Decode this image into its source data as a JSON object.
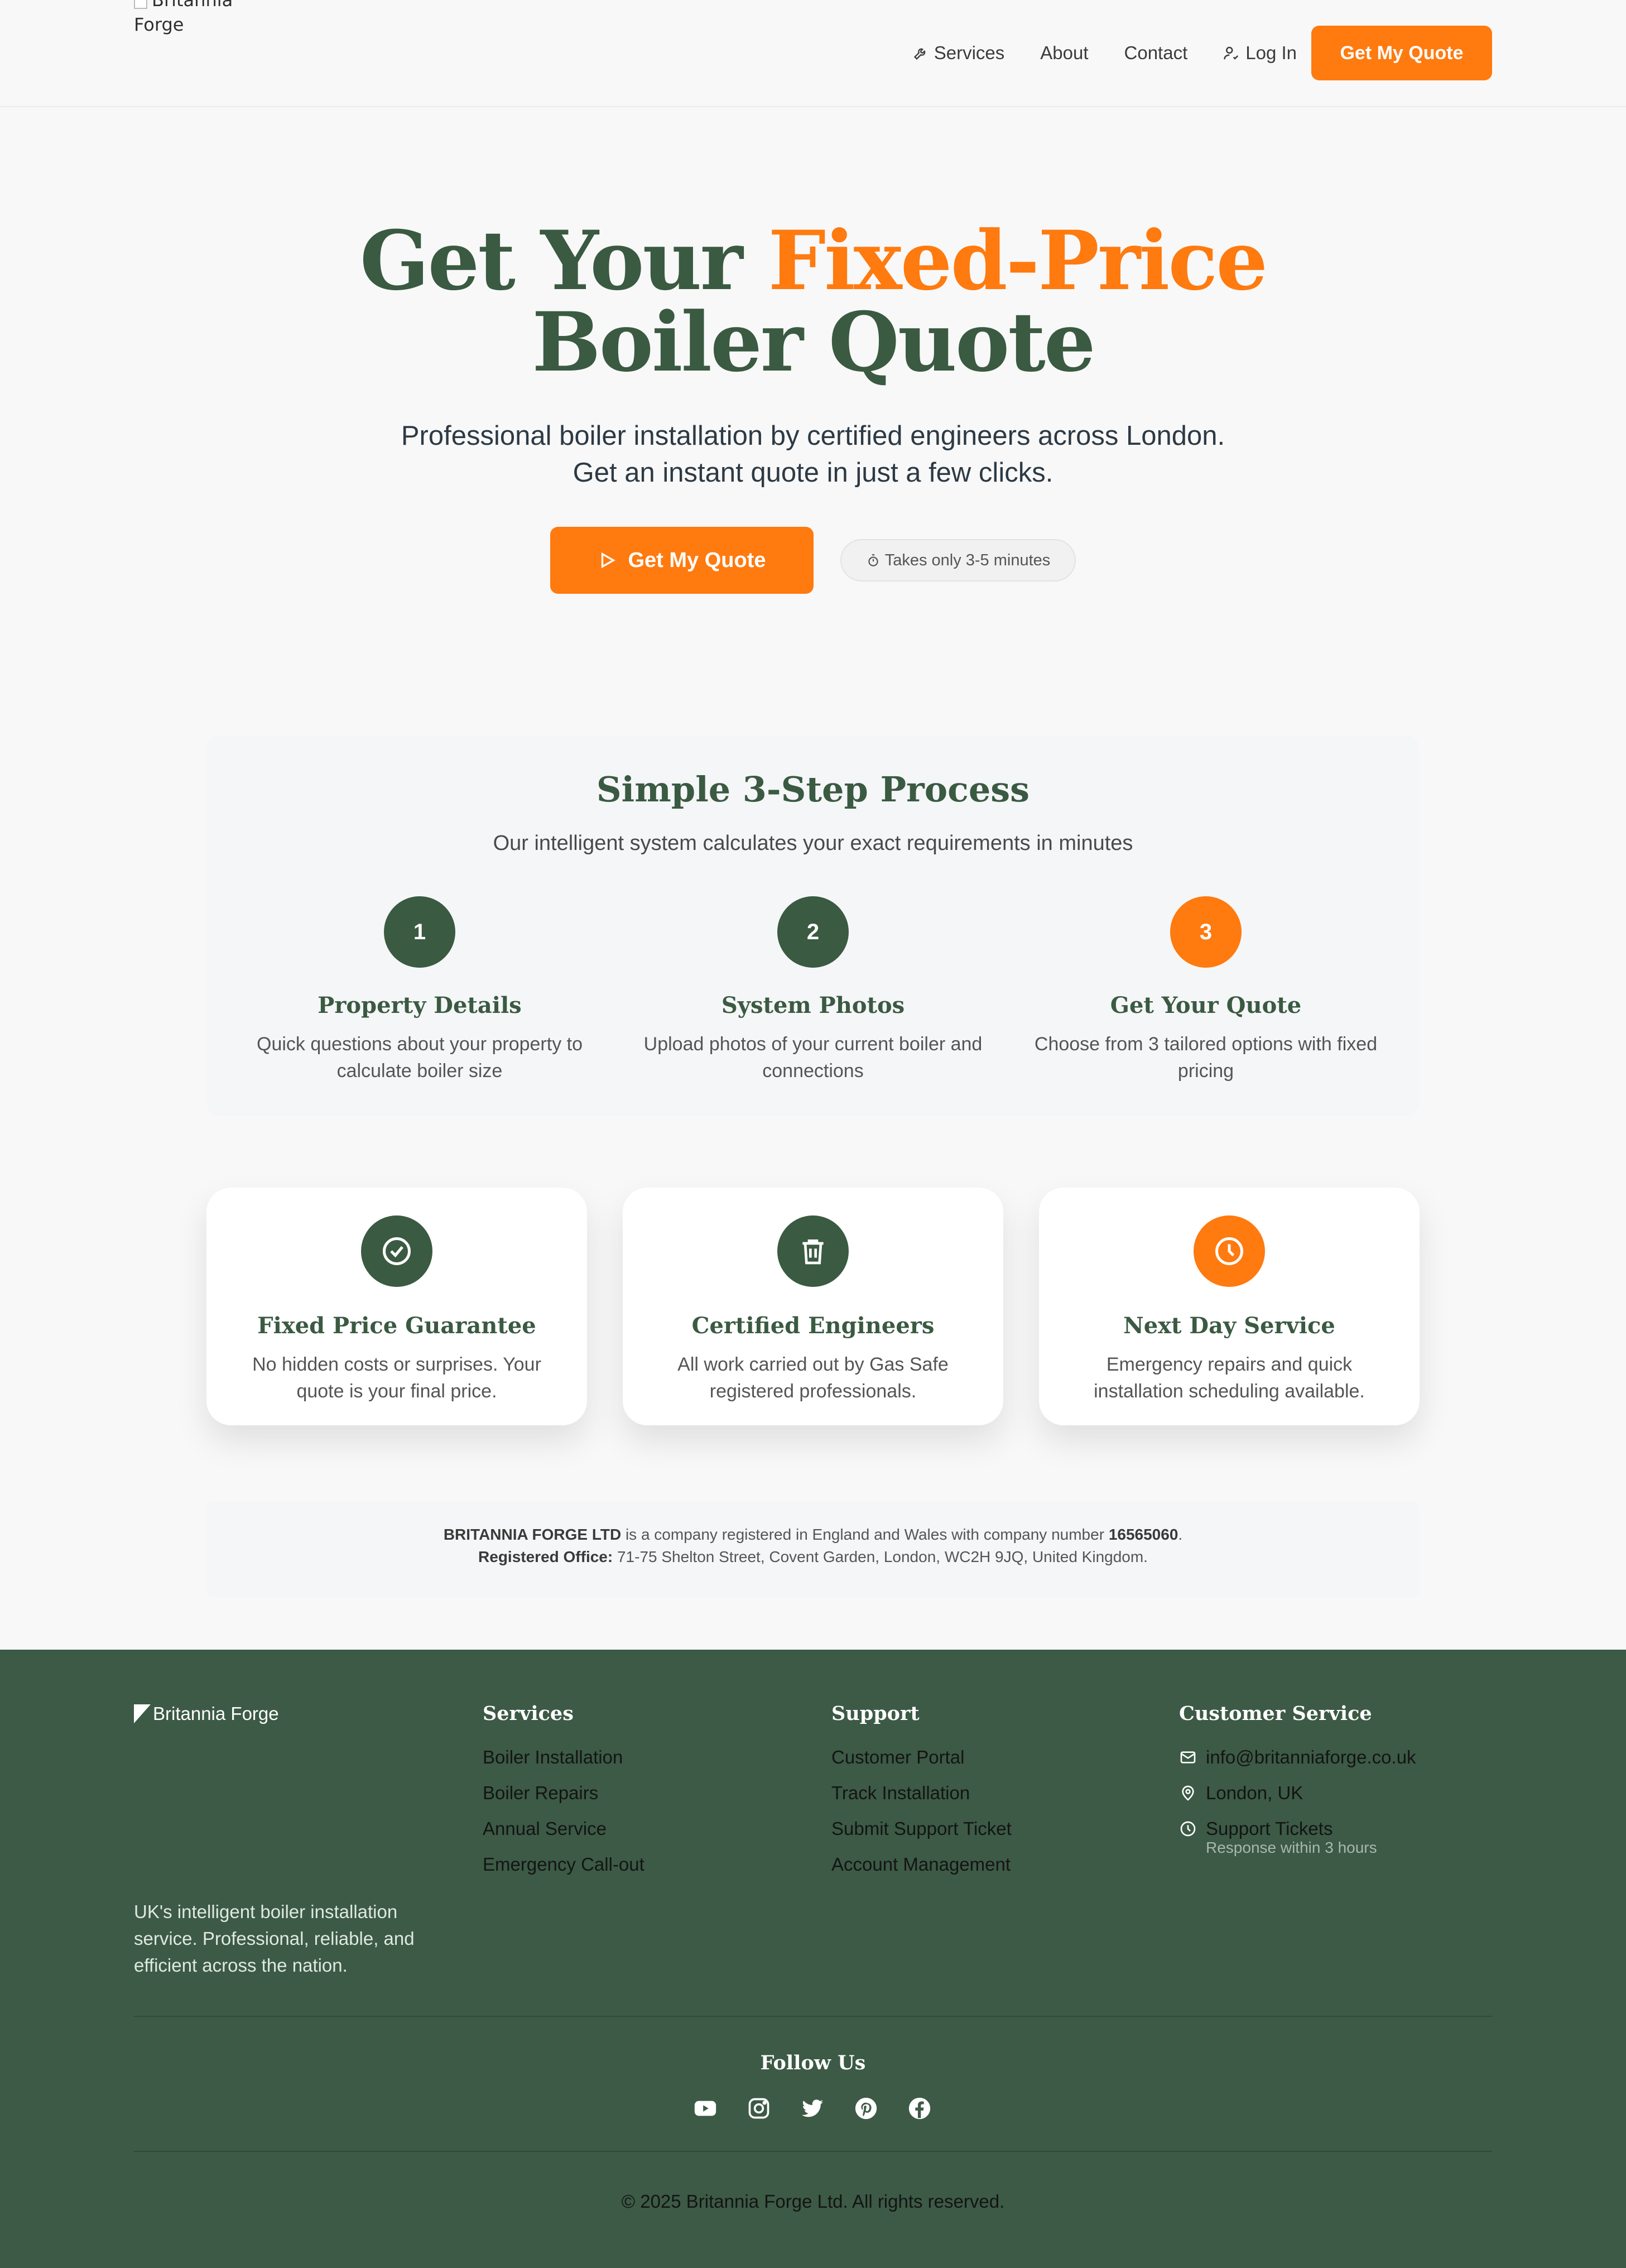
{
  "header": {
    "logo_text_line1": "Britannia",
    "logo_text_line2": "Forge",
    "nav": {
      "services": "Services",
      "about": "About",
      "contact": "Contact",
      "login": "Log In",
      "cta": "Get My Quote"
    }
  },
  "hero": {
    "title_part1": "Get Your ",
    "title_accent": "Fixed-Price",
    "title_line2": "Boiler Quote",
    "subtitle_line1": "Professional boiler installation by certified engineers across London.",
    "subtitle_line2": "Get an instant quote in just a few clicks.",
    "cta": "Get My Quote",
    "time_pill": "Takes only 3-5 minutes"
  },
  "process": {
    "title": "Simple 3-Step Process",
    "subtitle": "Our intelligent system calculates your exact requirements in minutes",
    "steps": [
      {
        "number": "1",
        "title": "Property Details",
        "desc": "Quick questions about your property to calculate boiler size"
      },
      {
        "number": "2",
        "title": "System Photos",
        "desc": "Upload photos of your current boiler and connections"
      },
      {
        "number": "3",
        "title": "Get Your Quote",
        "desc": "Choose from 3 tailored options with fixed pricing"
      }
    ]
  },
  "features": [
    {
      "icon": "check-circle-icon",
      "title": "Fixed Price Guarantee",
      "desc": "No hidden costs or surprises. Your quote is your final price."
    },
    {
      "icon": "trash-icon",
      "title": "Certified Engineers",
      "desc": "All work carried out by Gas Safe registered professionals."
    },
    {
      "icon": "clock-icon",
      "title": "Next Day Service",
      "desc": "Emergency repairs and quick installation scheduling available."
    }
  ],
  "company": {
    "name": "BRITANNIA FORGE LTD",
    "text1": " is a company registered in England and Wales with company number ",
    "number": "16565060",
    "text2": ".",
    "office_label": "Registered Office:",
    "office_address": " 71-75 Shelton Street, Covent Garden, London, WC2H 9JQ, United Kingdom."
  },
  "footer": {
    "logo_text": "Britannia Forge",
    "tagline": "UK's intelligent boiler installation service. Professional, reliable, and efficient across the nation.",
    "services": {
      "heading": "Services",
      "links": [
        "Boiler Installation",
        "Boiler Repairs",
        "Annual Service",
        "Emergency Call-out"
      ]
    },
    "support": {
      "heading": "Support",
      "links": [
        "Customer Portal",
        "Track Installation",
        "Submit Support Ticket",
        "Account Management"
      ]
    },
    "customer_service": {
      "heading": "Customer Service",
      "email": "info@britanniaforge.co.uk",
      "location": "London, UK",
      "tickets": "Support Tickets",
      "tickets_note": "Response within 3 hours"
    },
    "follow_heading": "Follow Us",
    "socials": [
      "youtube-icon",
      "instagram-icon",
      "twitter-icon",
      "pinterest-icon",
      "facebook-icon"
    ],
    "copyright": "© 2025 Britannia Forge Ltd. All rights reserved."
  },
  "colors": {
    "brand_green": "#3a5a42",
    "accent_orange": "#ff7a0f",
    "footer_bg": "#3c5a45"
  }
}
